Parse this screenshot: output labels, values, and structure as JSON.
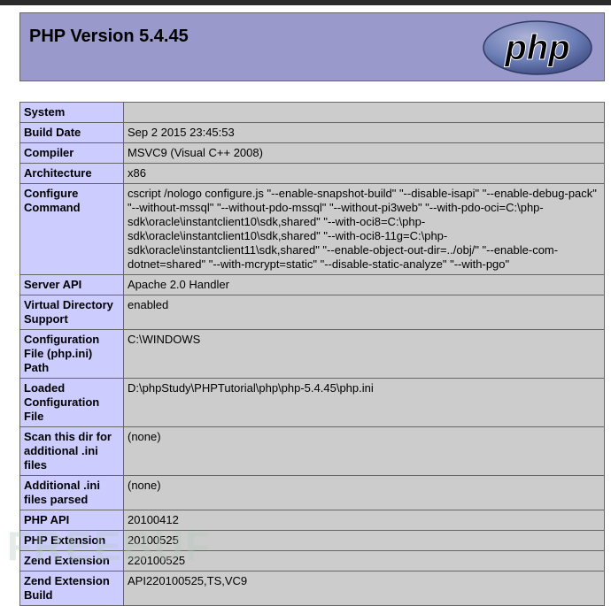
{
  "header": {
    "title": "PHP Version 5.4.45",
    "logo_text": "php",
    "logo_color": "#6c7eb7"
  },
  "rows": [
    {
      "label": "System",
      "value": ""
    },
    {
      "label": "Build Date",
      "value": "Sep 2 2015 23:45:53"
    },
    {
      "label": "Compiler",
      "value": "MSVC9 (Visual C++ 2008)"
    },
    {
      "label": "Architecture",
      "value": "x86"
    },
    {
      "label": "Configure Command",
      "value": "cscript /nologo configure.js \"--enable-snapshot-build\" \"--disable-isapi\" \"--enable-debug-pack\" \"--without-mssql\" \"--without-pdo-mssql\" \"--without-pi3web\" \"--with-pdo-oci=C:\\php-sdk\\oracle\\instantclient10\\sdk,shared\" \"--with-oci8=C:\\php-sdk\\oracle\\instantclient10\\sdk,shared\" \"--with-oci8-11g=C:\\php-sdk\\oracle\\instantclient11\\sdk,shared\" \"--enable-object-out-dir=../obj/\" \"--enable-com-dotnet=shared\" \"--with-mcrypt=static\" \"--disable-static-analyze\" \"--with-pgo\""
    },
    {
      "label": "Server API",
      "value": "Apache 2.0 Handler"
    },
    {
      "label": "Virtual Directory Support",
      "value": "enabled"
    },
    {
      "label": "Configuration File (php.ini) Path",
      "value": "C:\\WINDOWS"
    },
    {
      "label": "Loaded Configuration File",
      "value": "D:\\phpStudy\\PHPTutorial\\php\\php-5.4.45\\php.ini"
    },
    {
      "label": "Scan this dir for additional .ini files",
      "value": "(none)"
    },
    {
      "label": "Additional .ini files parsed",
      "value": "(none)"
    },
    {
      "label": "PHP API",
      "value": "20100412"
    },
    {
      "label": "PHP Extension",
      "value": "20100525"
    },
    {
      "label": "Zend Extension",
      "value": "220100525"
    },
    {
      "label": "Zend Extension Build",
      "value": "API220100525,TS,VC9"
    }
  ],
  "watermark": "FREEBUF"
}
